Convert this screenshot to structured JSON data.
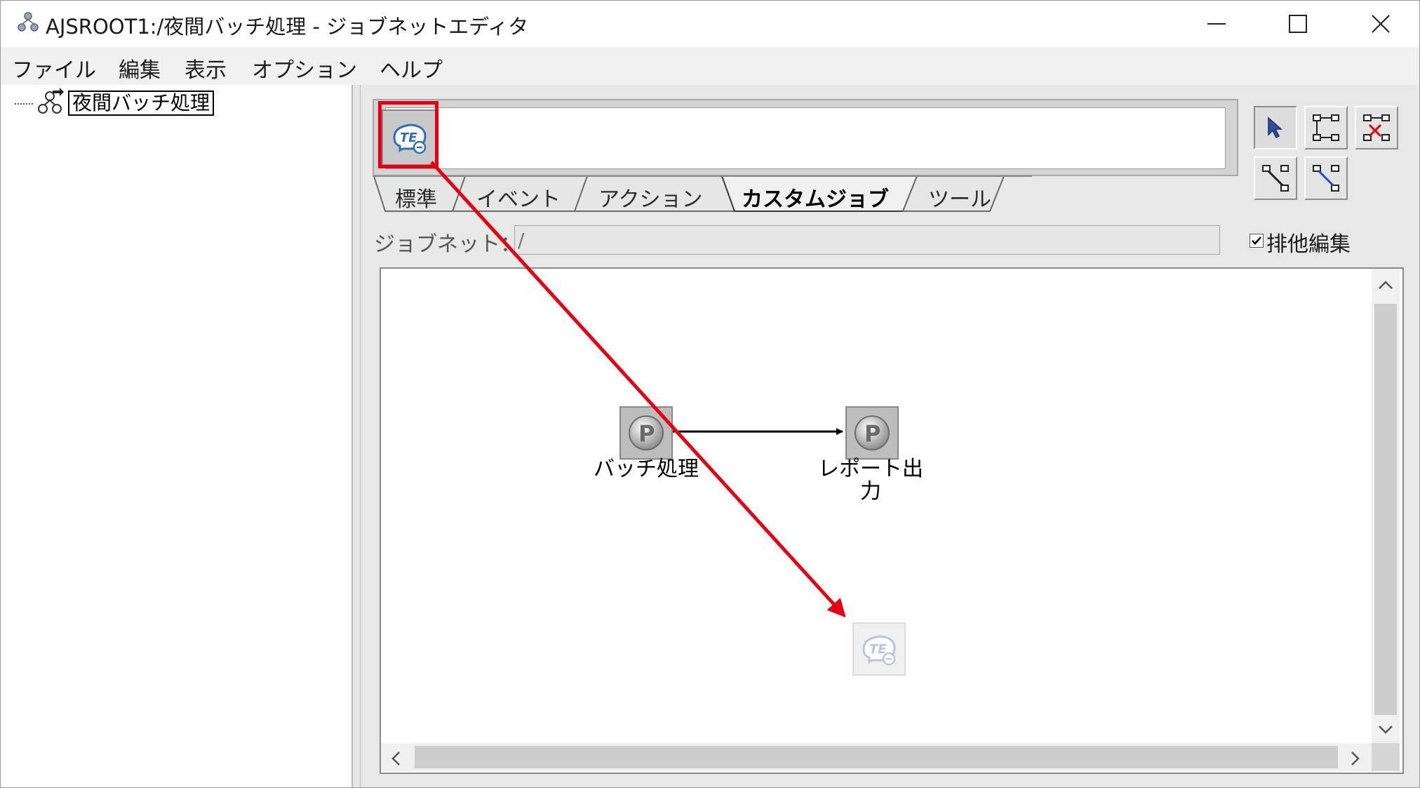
{
  "window": {
    "title": "AJSROOT1:/夜間バッチ処理 - ジョブネットエディタ"
  },
  "menu": {
    "file": "ファイル",
    "edit": "編集",
    "view": "表示",
    "option": "オプション",
    "help": "ヘルプ"
  },
  "tree": {
    "root_label": "夜間バッチ処理"
  },
  "palette": {
    "tabs": [
      {
        "label": "標準",
        "active": false
      },
      {
        "label": "イベント",
        "active": false
      },
      {
        "label": "アクション",
        "active": false
      },
      {
        "label": "カスタムジョブ",
        "active": true
      },
      {
        "label": "ツール",
        "active": false
      }
    ],
    "item_icon": "custom-job-te-icon"
  },
  "jobnet": {
    "label": "ジョブネット：",
    "path": "/",
    "exclusive_edit_label": "排他編集",
    "exclusive_edit_checked": true
  },
  "map": {
    "jobs": [
      {
        "label": "バッチ処理",
        "icon": "pc-job-p-icon"
      },
      {
        "label": "レポート出力",
        "icon": "pc-job-p-icon"
      }
    ],
    "dragged_icon": "custom-job-te-icon"
  },
  "colors": {
    "highlight": "#e60012",
    "drag_arrow": "#e60012"
  }
}
